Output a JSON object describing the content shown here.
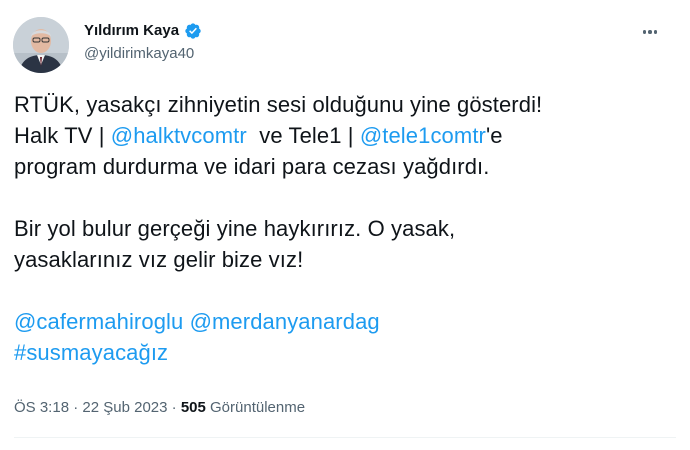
{
  "user": {
    "display_name": "Yıldırım Kaya",
    "handle": "@yildirimkaya40",
    "verified_color": "#1d9bf0"
  },
  "tweet": {
    "line1": "RTÜK, yasakçı zihniyetin sesi olduğunu yine gösterdi!",
    "line2_pre": "Halk TV | ",
    "mention_halktv": "@halktvcomtr",
    "line2_mid": "  ve Tele1 | ",
    "mention_tele1": "@tele1comtr",
    "line2_post": "'e",
    "line3": "program durdurma ve idari para cezası yağdırdı.",
    "line4": "Bir yol bulur gerçeği yine haykırırız. O yasak,",
    "line5": "yasaklarınız vız gelir bize vız!",
    "mention_cafer": "@cafermahiroglu",
    "mention_merdan": "@merdanyanardag",
    "hashtag": "#susmayacağız"
  },
  "meta": {
    "time": "ÖS 3:18",
    "separator": " · ",
    "date": "22 Şub 2023",
    "views_count": "505",
    "views_label": " Görüntülenme"
  },
  "colors": {
    "link": "#1d9bf0",
    "text": "#0f1419",
    "secondary": "#536471"
  },
  "icons": [
    "avatar",
    "verified-badge-icon",
    "more-options-icon"
  ]
}
